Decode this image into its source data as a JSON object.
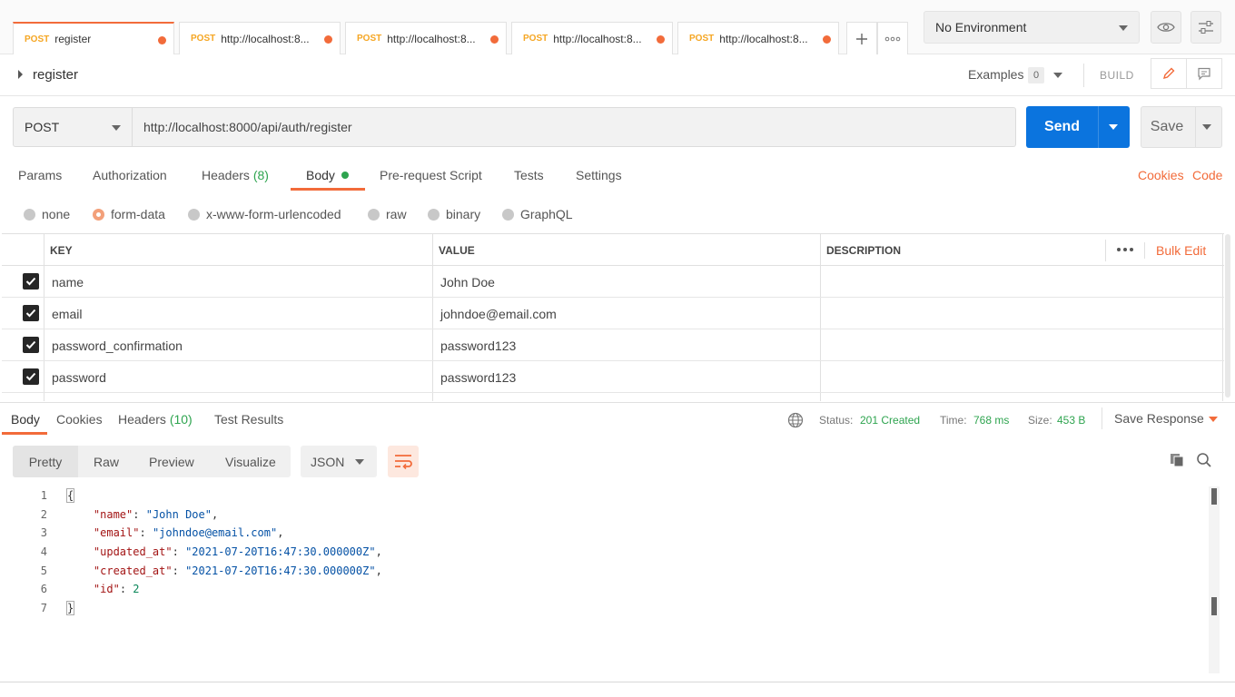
{
  "tabs": [
    {
      "method": "POST",
      "label": "register"
    },
    {
      "method": "POST",
      "label": "http://localhost:8..."
    },
    {
      "method": "POST",
      "label": "http://localhost:8..."
    },
    {
      "method": "POST",
      "label": "http://localhost:8..."
    },
    {
      "method": "POST",
      "label": "http://localhost:8..."
    }
  ],
  "environment": {
    "selected": "No Environment"
  },
  "request": {
    "name": "register",
    "method": "POST",
    "url": "http://localhost:8000/api/auth/register",
    "send_label": "Send",
    "save_label": "Save",
    "examples_label": "Examples",
    "examples_count": "0",
    "build_label": "BUILD"
  },
  "request_tabs": {
    "params": "Params",
    "authorization": "Authorization",
    "headers": "Headers",
    "headers_count": "(8)",
    "body": "Body",
    "prerequest": "Pre-request Script",
    "tests": "Tests",
    "settings": "Settings",
    "cookies": "Cookies",
    "code": "Code"
  },
  "body_types": {
    "selected": "form-data",
    "options": [
      "none",
      "form-data",
      "x-www-form-urlencoded",
      "raw",
      "binary",
      "GraphQL"
    ]
  },
  "form_table": {
    "headers": {
      "key": "KEY",
      "value": "VALUE",
      "description": "DESCRIPTION"
    },
    "bulk_edit": "Bulk Edit",
    "rows": [
      {
        "key": "name",
        "value": "John Doe",
        "checked": true
      },
      {
        "key": "email",
        "value": "johndoe@email.com",
        "checked": true
      },
      {
        "key": "password_confirmation",
        "value": "password123",
        "checked": true
      },
      {
        "key": "password",
        "value": "password123",
        "checked": true
      }
    ]
  },
  "response": {
    "tabs": {
      "body": "Body",
      "cookies": "Cookies",
      "headers": "Headers",
      "headers_count": "(10)",
      "test_results": "Test Results"
    },
    "status_label": "Status:",
    "status": "201 Created",
    "time_label": "Time:",
    "time": "768 ms",
    "size_label": "Size:",
    "size": "453 B",
    "save_response": "Save Response",
    "views": {
      "pretty": "Pretty",
      "raw": "Raw",
      "preview": "Preview",
      "visualize": "Visualize",
      "selected": "Pretty"
    },
    "format": "JSON",
    "code_lines": [
      {
        "num": "1",
        "text": "{"
      },
      {
        "num": "2",
        "key": "\"name\"",
        "value": "\"John Doe\"",
        "type": "string",
        "comma": ","
      },
      {
        "num": "3",
        "key": "\"email\"",
        "value": "\"johndoe@email.com\"",
        "type": "string",
        "comma": ","
      },
      {
        "num": "4",
        "key": "\"updated_at\"",
        "value": "\"2021-07-20T16:47:30.000000Z\"",
        "type": "string",
        "comma": ","
      },
      {
        "num": "5",
        "key": "\"created_at\"",
        "value": "\"2021-07-20T16:47:30.000000Z\"",
        "type": "string",
        "comma": ","
      },
      {
        "num": "6",
        "key": "\"id\"",
        "value": "2",
        "type": "number",
        "comma": ""
      },
      {
        "num": "7",
        "text": "}"
      }
    ]
  },
  "colors": {
    "accent": "#f26b3a",
    "send": "#0b74de",
    "success": "#2ea44f",
    "tab_method": "#f5a623"
  },
  "icons": [
    "plus-icon",
    "more-icon",
    "eye-icon",
    "sliders-icon",
    "pencil-icon",
    "comment-icon",
    "globe-icon",
    "copy-icon",
    "search-icon",
    "wrap-lines-icon",
    "chevron-down-icon"
  ]
}
